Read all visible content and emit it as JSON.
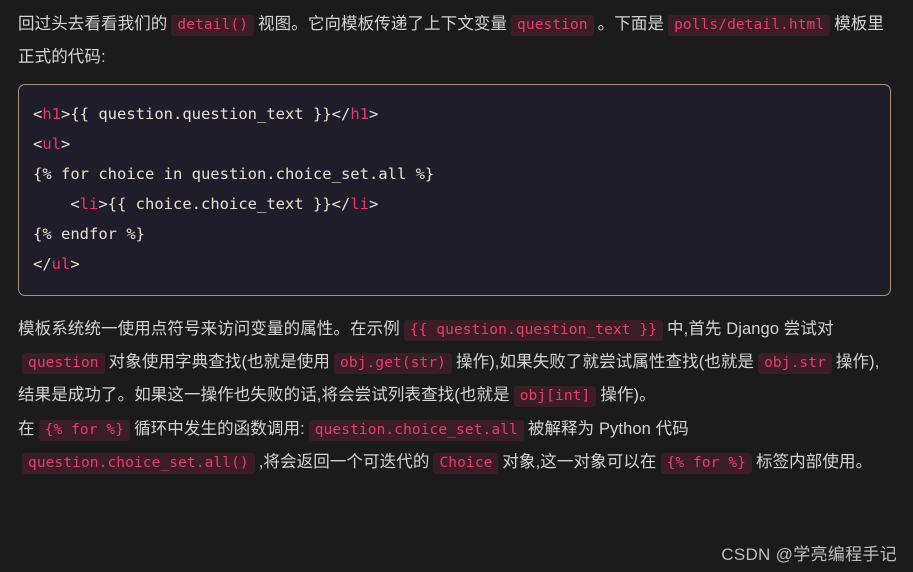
{
  "page": {
    "background_color": "#1b1b1b",
    "text_color": "#d4d4d4"
  },
  "colors": {
    "inline_code_text": "#e83e6d",
    "inline_code_bg": "#3a1d26",
    "code_block_bg": "#201d2b",
    "code_block_border": "#a39382",
    "code_tag": "#e8386b",
    "code_plain": "#e8e2d4",
    "watermark": "#bfbfbf"
  },
  "intro_paragraph": {
    "t1": "回过头去看看我们的",
    "code1": "detail()",
    "t2": "视图。它向模板传递了上下文变量",
    "code2": "question",
    "t3": "。下面是",
    "code3": "polls/detail.html",
    "t4": "模板里正式的代码:"
  },
  "code_block": {
    "language": "html",
    "lines": [
      {
        "segments": [
          {
            "type": "punct",
            "text": "<"
          },
          {
            "type": "tag",
            "text": "h1"
          },
          {
            "type": "punct",
            "text": ">{{ question.question_text }}</"
          },
          {
            "type": "tag",
            "text": "h1"
          },
          {
            "type": "punct",
            "text": ">"
          }
        ]
      },
      {
        "segments": [
          {
            "type": "punct",
            "text": "<"
          },
          {
            "type": "tag",
            "text": "ul"
          },
          {
            "type": "punct",
            "text": ">"
          }
        ]
      },
      {
        "segments": [
          {
            "type": "plain",
            "text": "{% for choice in question.choice_set.all %}"
          }
        ]
      },
      {
        "segments": [
          {
            "type": "plain",
            "text": "    <"
          },
          {
            "type": "tag",
            "text": "li"
          },
          {
            "type": "punct",
            "text": ">{{ choice.choice_text }}</"
          },
          {
            "type": "tag",
            "text": "li"
          },
          {
            "type": "punct",
            "text": ">"
          }
        ]
      },
      {
        "segments": [
          {
            "type": "plain",
            "text": "{% endfor %}"
          }
        ]
      },
      {
        "segments": [
          {
            "type": "punct",
            "text": "</"
          },
          {
            "type": "tag",
            "text": "ul"
          },
          {
            "type": "punct",
            "text": ">"
          }
        ]
      }
    ]
  },
  "body_paragraph": {
    "t1": "模板系统统一使用点符号来访问变量的属性。在示例",
    "code1": "{{ question.question_text }}",
    "t2": "中,首先 Django 尝试对",
    "code2": "question",
    "t3": "对象使用字典查找(也就是使用",
    "code3": "obj.get(str)",
    "t4": "操作),如果失败了就尝试属性查找(也就是",
    "code4": "obj.str",
    "t5": "操作),结果是成功了。如果这一操作也失败的话,将会尝试列表查找(也就是",
    "code5": "obj[int]",
    "t6": "操作)。"
  },
  "tail_paragraph": {
    "t1": "在",
    "code1": "{% for %}",
    "t2": "循环中发生的函数调用:",
    "code2": "question.choice_set.all",
    "t3": "被解释为 Python 代码",
    "code3": "question.choice_set.all()",
    "t4": ",将会返回一个可迭代的",
    "code4": "Choice",
    "t5": "对象,这一对象可以在",
    "code5": "{% for %}",
    "t6": "标签内部使用。"
  },
  "watermark": {
    "text": "CSDN @学亮编程手记"
  }
}
